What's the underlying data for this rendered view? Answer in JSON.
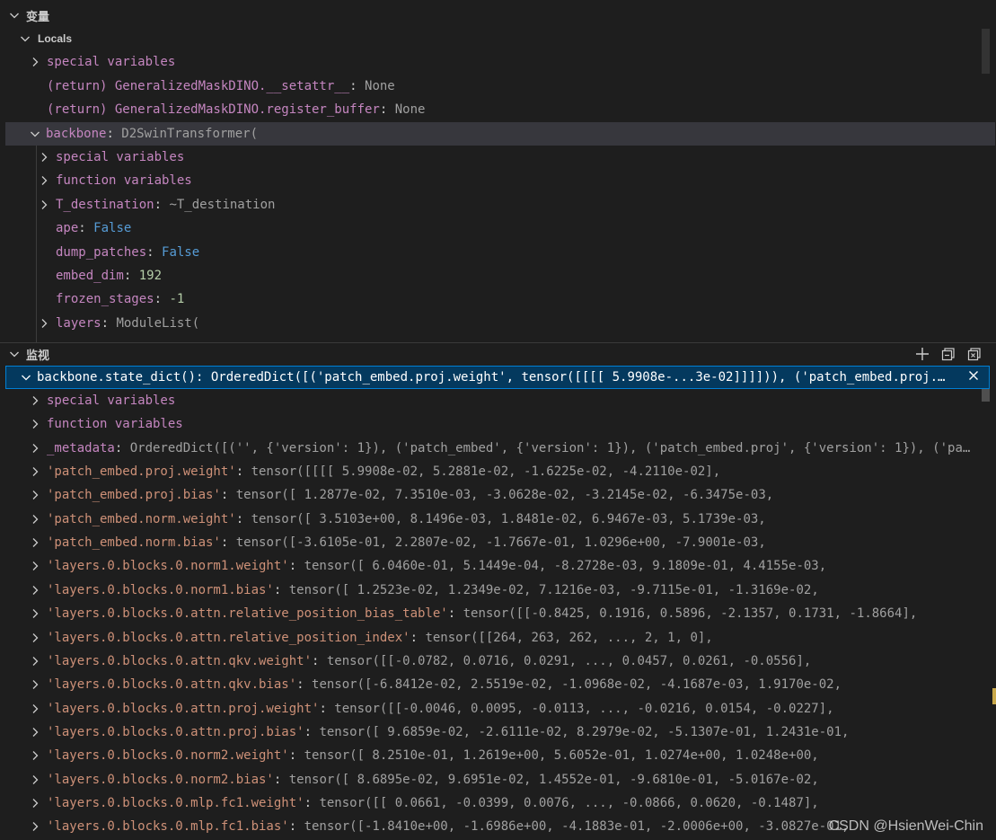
{
  "variables_section": {
    "title": "变量",
    "locals_title": "Locals",
    "items": [
      {
        "name": "special variables",
        "value": ""
      },
      {
        "name": "(return) GeneralizedMaskDINO.__setattr__",
        "value": "None"
      },
      {
        "name": "(return) GeneralizedMaskDINO.register_buffer",
        "value": "None"
      },
      {
        "name": "backbone",
        "value": "D2SwinTransformer("
      }
    ],
    "backbone_children": [
      {
        "name": "special variables",
        "value": ""
      },
      {
        "name": "function variables",
        "value": ""
      },
      {
        "name": "T_destination",
        "value": "~T_destination"
      },
      {
        "name": "ape",
        "value": "False"
      },
      {
        "name": "dump_patches",
        "value": "False"
      },
      {
        "name": "embed_dim",
        "value": "192"
      },
      {
        "name": "frozen_stages",
        "value": "-1"
      },
      {
        "name": "layers",
        "value": "ModuleList("
      }
    ]
  },
  "watch_section": {
    "title": "监视",
    "expression": "backbone.state_dict()",
    "expression_value": "OrderedDict([('patch_embed.proj.weight', tensor([[[[ 5.9908e-...3e-02]]]])), ('patch_embed.proj.…",
    "items": [
      {
        "name": "special variables",
        "value": ""
      },
      {
        "name": "function variables",
        "value": ""
      },
      {
        "name": "_metadata",
        "value": "OrderedDict([('', {'version': 1}), ('patch_embed', {'version': 1}), ('patch_embed.proj', {'version': 1}), ('pa…"
      },
      {
        "name": "'patch_embed.proj.weight'",
        "value": "tensor([[[[ 5.9908e-02,  5.2881e-02, -1.6225e-02, -4.2110e-02],"
      },
      {
        "name": "'patch_embed.proj.bias'",
        "value": "tensor([ 1.2877e-02,  7.3510e-03, -3.0628e-02, -3.2145e-02, -6.3475e-03,"
      },
      {
        "name": "'patch_embed.norm.weight'",
        "value": "tensor([ 3.5103e+00,  8.1496e-03,  1.8481e-02,  6.9467e-03,  5.1739e-03,"
      },
      {
        "name": "'patch_embed.norm.bias'",
        "value": "tensor([-3.6105e-01,  2.2807e-02, -1.7667e-01,  1.0296e+00, -7.9001e-03,"
      },
      {
        "name": "'layers.0.blocks.0.norm1.weight'",
        "value": "tensor([ 6.0460e-01,  5.1449e-04, -8.2728e-03,  9.1809e-01,  4.4155e-03,"
      },
      {
        "name": "'layers.0.blocks.0.norm1.bias'",
        "value": "tensor([ 1.2523e-02,  1.2349e-02,  7.1216e-03, -9.7115e-01, -1.3169e-02,"
      },
      {
        "name": "'layers.0.blocks.0.attn.relative_position_bias_table'",
        "value": "tensor([[-0.8425,  0.1916,  0.5896, -2.1357,  0.1731, -1.8664],"
      },
      {
        "name": "'layers.0.blocks.0.attn.relative_position_index'",
        "value": "tensor([[264, 263, 262,  ...,   2,   1,   0],"
      },
      {
        "name": "'layers.0.blocks.0.attn.qkv.weight'",
        "value": "tensor([[-0.0782,  0.0716,  0.0291,  ...,  0.0457,  0.0261, -0.0556],"
      },
      {
        "name": "'layers.0.blocks.0.attn.qkv.bias'",
        "value": "tensor([-6.8412e-02,  2.5519e-02, -1.0968e-02, -4.1687e-03,  1.9170e-02,"
      },
      {
        "name": "'layers.0.blocks.0.attn.proj.weight'",
        "value": "tensor([[-0.0046,  0.0095, -0.0113,  ..., -0.0216,  0.0154, -0.0227],"
      },
      {
        "name": "'layers.0.blocks.0.attn.proj.bias'",
        "value": "tensor([ 9.6859e-02, -2.6111e-02,  8.2979e-02, -5.1307e-01,  1.2431e-01,"
      },
      {
        "name": "'layers.0.blocks.0.norm2.weight'",
        "value": "tensor([ 8.2510e-01,  1.2619e+00,  5.6052e-01,  1.0274e+00,  1.0248e+00,"
      },
      {
        "name": "'layers.0.blocks.0.norm2.bias'",
        "value": "tensor([ 8.6895e-02,  9.6951e-02,  1.4552e-01, -9.6810e-01, -5.0167e-02,"
      },
      {
        "name": "'layers.0.blocks.0.mlp.fc1.weight'",
        "value": "tensor([[ 0.0661, -0.0399,  0.0076,  ..., -0.0866,  0.0620, -0.1487],"
      },
      {
        "name": "'layers.0.blocks.0.mlp.fc1.bias'",
        "value": "tensor([-1.8410e+00, -1.6986e+00, -4.1883e-01, -2.0006e+00, -3.0827e-01,"
      }
    ]
  },
  "watermark": "CSDN @HsienWei-Chin",
  "colors": {
    "background": "#1e1e1e",
    "name": "#c586c0",
    "boolean": "#569cd6",
    "number": "#b5cea8",
    "selected_row": "#37373d",
    "focus_border": "#007fd4"
  }
}
